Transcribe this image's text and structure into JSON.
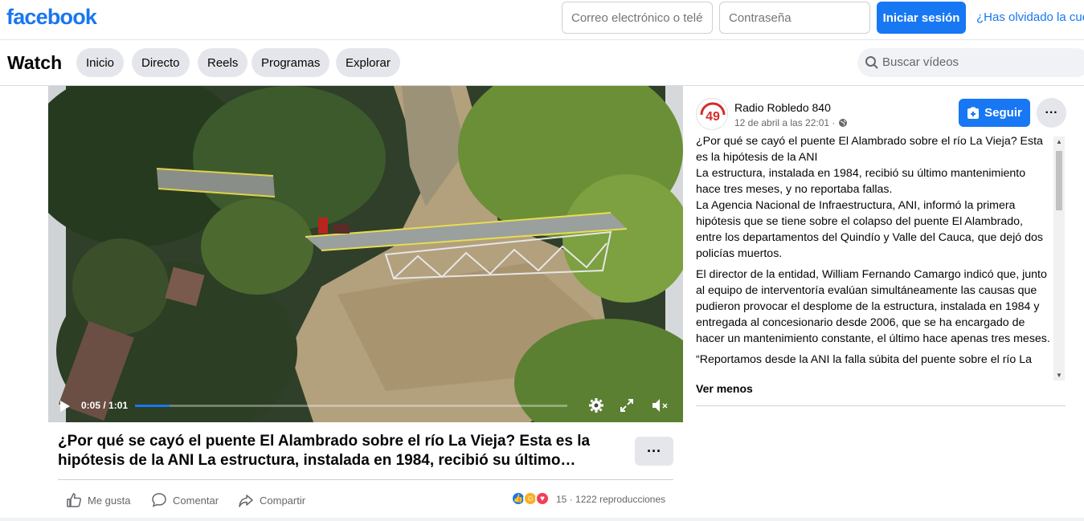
{
  "header": {
    "logo": "facebook",
    "email_placeholder": "Correo electrónico o teléfono",
    "password_placeholder": "Contraseña",
    "login_label": "Iniciar sesión",
    "forgot_label": "¿Has olvidado la cuenta?"
  },
  "watch_nav": {
    "title": "Watch",
    "tabs": [
      "Inicio",
      "Directo",
      "Reels",
      "Programas",
      "Explorar"
    ],
    "search_placeholder": "Buscar vídeos"
  },
  "video": {
    "time": "0:05 / 1:01",
    "progress_fraction": 0.08
  },
  "post": {
    "title": "¿Por qué se cayó el puente El Alambrado sobre el río La Vieja? Esta es la hipótesis de la ANI La estructura, instalada en 1984, recibió su último…",
    "more_label": "···",
    "actions": {
      "like": "Me gusta",
      "comment": "Comentar",
      "share": "Compartir"
    },
    "reaction_count": "15",
    "views": "1222 reproducciones"
  },
  "sidebar": {
    "page_name": "Radio Robledo 840",
    "date": "12 de abril a las 22:01 ·",
    "avatar_text": "49",
    "follow_label": "Seguir",
    "dots_label": "···",
    "description": [
      "¿Por qué se cayó el puente El Alambrado sobre el río La Vieja? Esta es la hipótesis de la ANI\nLa estructura, instalada en 1984, recibió su último mantenimiento hace tres meses, y no reportaba fallas.\nLa Agencia Nacional de Infraestructura, ANI, informó la primera hipótesis que se tiene sobre el colapso del puente El Alambrado, entre los departamentos del Quindío y Valle del Cauca, que dejó dos policías muertos.",
      "El director de la entidad, William Fernando Camargo indicó que, junto al equipo de interventoría evalúan simultáneamente las causas que pudieron provocar el desplome de la estructura, instalada en 1984 y entregada al concesionario desde 2006, que se ha encargado de hacer un mantenimiento constante, el último hace apenas tres meses.",
      "“Reportamos desde la ANI la falla súbita del puente sobre el río La"
    ],
    "see_less": "Ver menos"
  },
  "colors": {
    "brand": "#1877f2",
    "like": "#1877f2",
    "care": "#f7b125",
    "love": "#f33e58"
  },
  "icons": [
    "search-icon",
    "play-icon",
    "settings-icon",
    "fullscreen-icon",
    "mute-icon",
    "like-icon",
    "comment-icon",
    "share-icon",
    "globe-icon",
    "follow-icon"
  ]
}
